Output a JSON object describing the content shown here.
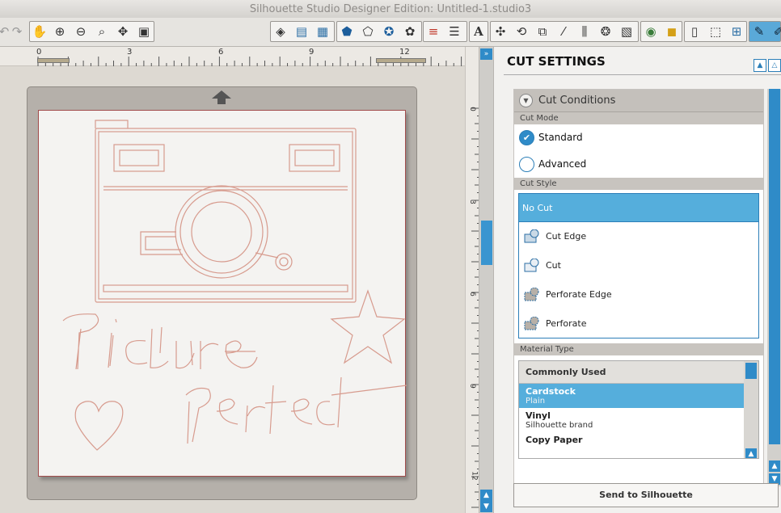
{
  "window": {
    "title": "Silhouette Studio Designer Edition: Untitled-1.studio3"
  },
  "toolbar": {
    "icons": [
      "undo-icon",
      "redo-icon",
      "pan-hand-icon",
      "zoom-in-icon",
      "zoom-out-icon",
      "zoom-select-icon",
      "drag-zoom-icon",
      "fit-to-page-icon",
      "fill-color-icon",
      "gradient-icon",
      "fill-pattern-icon",
      "shape-pentagon-icon",
      "shape-polygon-icon",
      "shape-star-icon",
      "shape-flower-icon",
      "line-color-icon",
      "line-style-icon",
      "text-icon",
      "transform-icon",
      "rotate-icon",
      "scale-icon",
      "shear-icon",
      "replicate-icon",
      "offset-icon",
      "modify-icon",
      "store-icon",
      "library-icon",
      "page-setup-icon",
      "cut-settings-icon",
      "registration-icon",
      "grid-icon",
      "send-pen-icon",
      "send-cut-icon"
    ],
    "text_glyph": "A"
  },
  "ruler": {
    "h_labels": [
      "0",
      "3",
      "6",
      "9",
      "12"
    ],
    "v_labels": [
      "0",
      "3",
      "6",
      "9",
      "12"
    ]
  },
  "panel": {
    "title": "CUT SETTINGS",
    "cut_conditions": {
      "header": "Cut Conditions",
      "cut_mode_label": "Cut Mode",
      "modes": [
        {
          "label": "Standard",
          "selected": true
        },
        {
          "label": "Advanced",
          "selected": false
        }
      ],
      "cut_style_label": "Cut Style",
      "styles": [
        {
          "label": "No Cut",
          "selected": true
        },
        {
          "label": "Cut Edge"
        },
        {
          "label": "Cut"
        },
        {
          "label": "Perforate Edge"
        },
        {
          "label": "Perforate"
        }
      ],
      "material_type_label": "Material Type",
      "materials_header": "Commonly Used",
      "materials": [
        {
          "name": "Cardstock",
          "sub": "Plain",
          "selected": true
        },
        {
          "name": "Vinyl",
          "sub": "Silhouette brand"
        },
        {
          "name": "Copy Paper",
          "sub": ""
        }
      ]
    },
    "send_button": "Send to Silhouette"
  },
  "colors": {
    "accent": "#2f8bc8",
    "selection": "#55aedc",
    "cut_line": "#d79b8e"
  }
}
